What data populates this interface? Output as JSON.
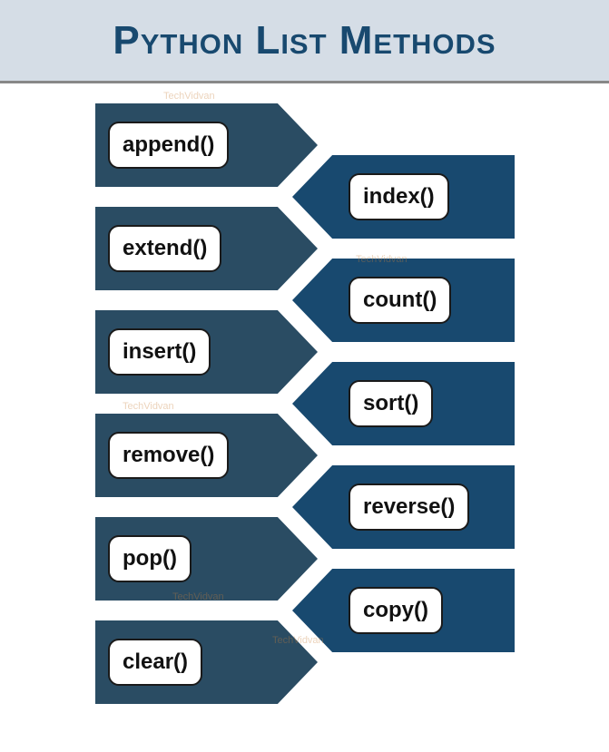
{
  "header": {
    "title": "Python List Methods"
  },
  "colors": {
    "header_bg": "#d5dde6",
    "title": "#18496f",
    "left_arrow": "#2a4c63",
    "right_arrow": "#18496f"
  },
  "watermark": "TechVidvan",
  "left_methods": [
    {
      "label": "append()"
    },
    {
      "label": "extend()"
    },
    {
      "label": "insert()"
    },
    {
      "label": "remove()"
    },
    {
      "label": "pop()"
    },
    {
      "label": "clear()"
    }
  ],
  "right_methods": [
    {
      "label": "index()"
    },
    {
      "label": "count()"
    },
    {
      "label": "sort()"
    },
    {
      "label": "reverse()"
    },
    {
      "label": "copy()"
    }
  ]
}
